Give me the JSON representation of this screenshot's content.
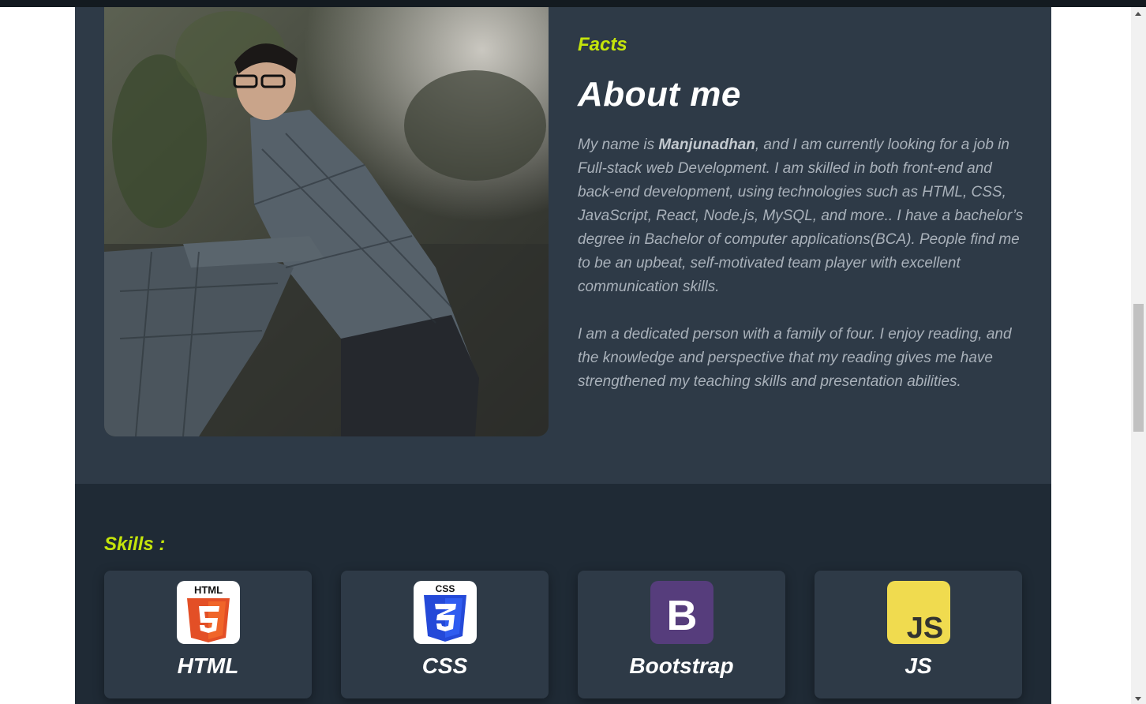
{
  "about": {
    "eyebrow": "Facts",
    "title": "About me",
    "bio1_prefix": "My name is ",
    "bio1_name": "Manjunadhan",
    "bio1_rest": ", and I am currently looking for a job in Full-stack web Development. I am skilled in both front-end and back-end development, using technologies such as HTML, CSS, JavaScript, React, Node.js, MySQL, and more.. I have a bachelor’s degree in Bachelor of computer applications(BCA). People find me to be an upbeat, self-motivated team player with excellent communication skills.",
    "bio2": "I am a dedicated person with a family of four. I enjoy reading, and the knowledge and perspective that my reading gives me have strengthened my teaching skills and presentation abilities."
  },
  "skills": {
    "title": "Skills :",
    "items": [
      {
        "label": "HTML",
        "icon": "html5-icon",
        "badge": "HTML",
        "color": "#e34f26"
      },
      {
        "label": "CSS",
        "icon": "css3-icon",
        "badge": "CSS",
        "color": "#1572b6"
      },
      {
        "label": "Bootstrap",
        "icon": "bootstrap-icon",
        "badge": "B",
        "color": "#563d7c"
      },
      {
        "label": "JS",
        "icon": "javascript-icon",
        "badge": "JS",
        "color": "#f0db4f"
      }
    ]
  },
  "colors": {
    "accent": "#c4e40b",
    "about_bg": "#2e3a47",
    "skills_bg": "#1f2a35"
  }
}
